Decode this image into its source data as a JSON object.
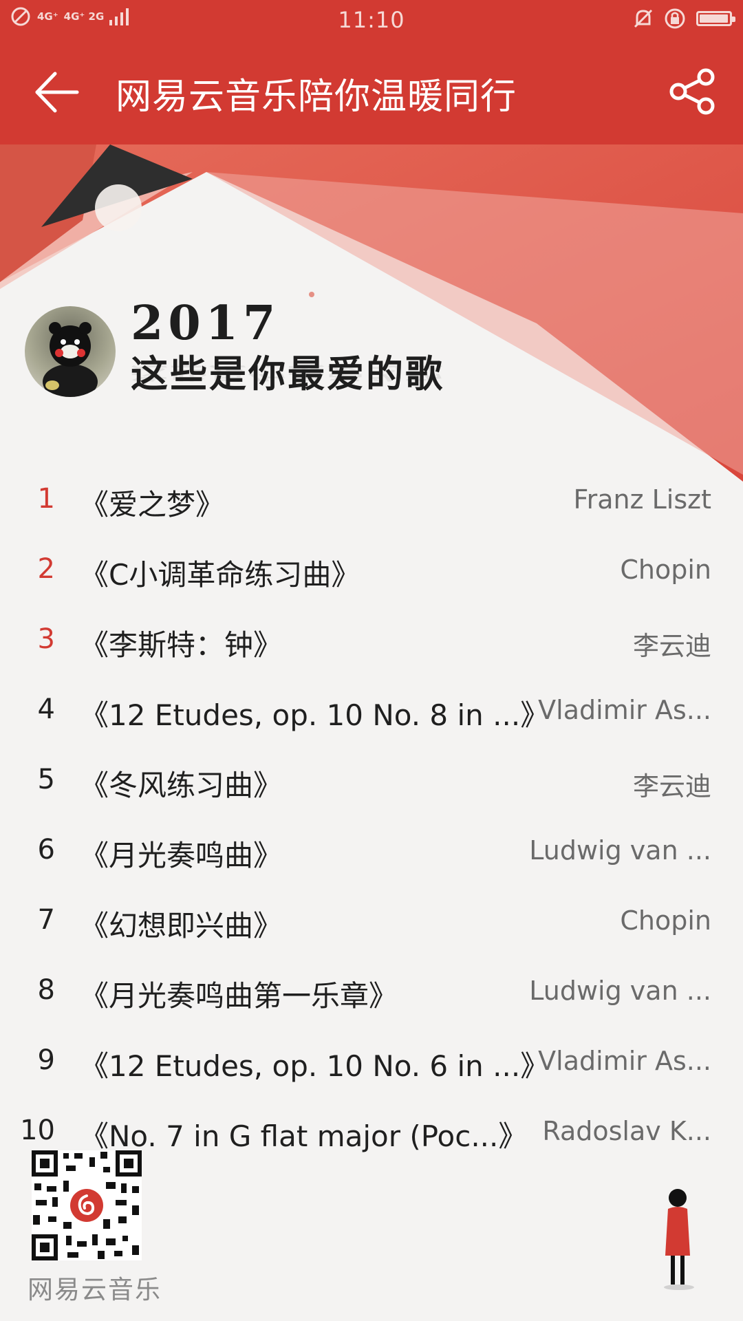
{
  "status_bar": {
    "network_1": "4G⁺",
    "network_2": "4G⁺ 2G",
    "time": "11:10",
    "icons": [
      "no-signal-icon",
      "mute-icon",
      "rotation-lock-icon",
      "battery-icon"
    ],
    "battery_level": 0.9
  },
  "header": {
    "title": "网易云音乐陪你温暖同行",
    "back_icon": "arrow-left-icon",
    "share_icon": "share-icon"
  },
  "hero": {
    "year": "2017",
    "subtitle": "这些是你最爱的歌"
  },
  "songs": [
    {
      "rank": "1",
      "title": "《爱之梦》",
      "artist": "Franz Liszt"
    },
    {
      "rank": "2",
      "title": "《C小调革命练习曲》",
      "artist": "Chopin"
    },
    {
      "rank": "3",
      "title": "《李斯特：钟》",
      "artist": "李云迪"
    },
    {
      "rank": "4",
      "title": "《12 Etudes, op. 10 No. 8 in ...》",
      "artist": "Vladimir As..."
    },
    {
      "rank": "5",
      "title": "《冬风练习曲》",
      "artist": "李云迪"
    },
    {
      "rank": "6",
      "title": "《月光奏鸣曲》",
      "artist": "Ludwig van ..."
    },
    {
      "rank": "7",
      "title": "《幻想即兴曲》",
      "artist": "Chopin"
    },
    {
      "rank": "8",
      "title": "《月光奏鸣曲第一乐章》",
      "artist": "Ludwig van ..."
    },
    {
      "rank": "9",
      "title": "《12 Etudes, op. 10 No. 6 in ...》",
      "artist": "Vladimir As..."
    },
    {
      "rank": "10",
      "title": "《No. 7 in G flat major (Poc...》",
      "artist": "Radoslav K..."
    }
  ],
  "footer": {
    "brand": "网易云音乐",
    "qr_icon": "qr-code-icon",
    "figure_icon": "person-figure-icon"
  },
  "colors": {
    "brand_red": "#d23a32",
    "rank_highlight": "#d23a32"
  }
}
